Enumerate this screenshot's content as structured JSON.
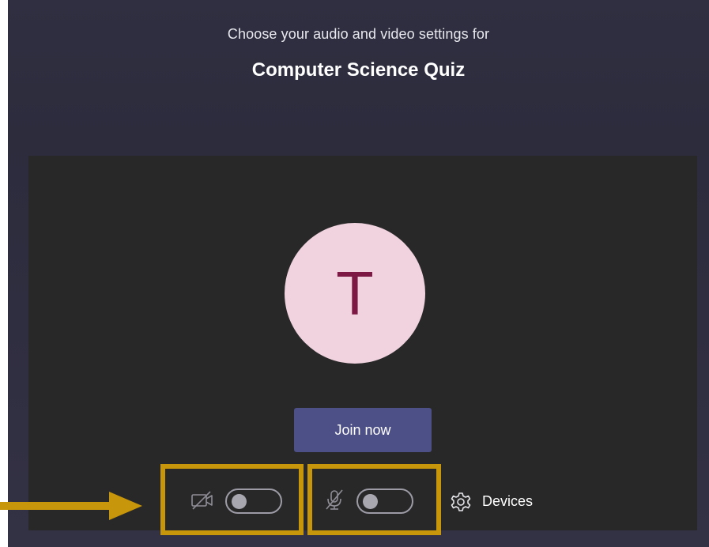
{
  "header": {
    "subtitle": "Choose your audio and video settings for",
    "meeting_title": "Computer Science Quiz"
  },
  "preview": {
    "avatar_initial": "T",
    "join_label": "Join now"
  },
  "controls": {
    "camera_toggle": {
      "state": "off",
      "icon": "camera-off-icon"
    },
    "mic_toggle": {
      "state": "off",
      "icon": "mic-off-icon"
    },
    "devices_label": "Devices",
    "devices_icon": "gear-icon"
  },
  "colors": {
    "background": "#2f2f41",
    "preview": "#292828",
    "avatar_bg": "#f1d3e0",
    "avatar_text": "#7c1843",
    "join_button": "#4d4f87",
    "highlight": "#c7960a"
  }
}
